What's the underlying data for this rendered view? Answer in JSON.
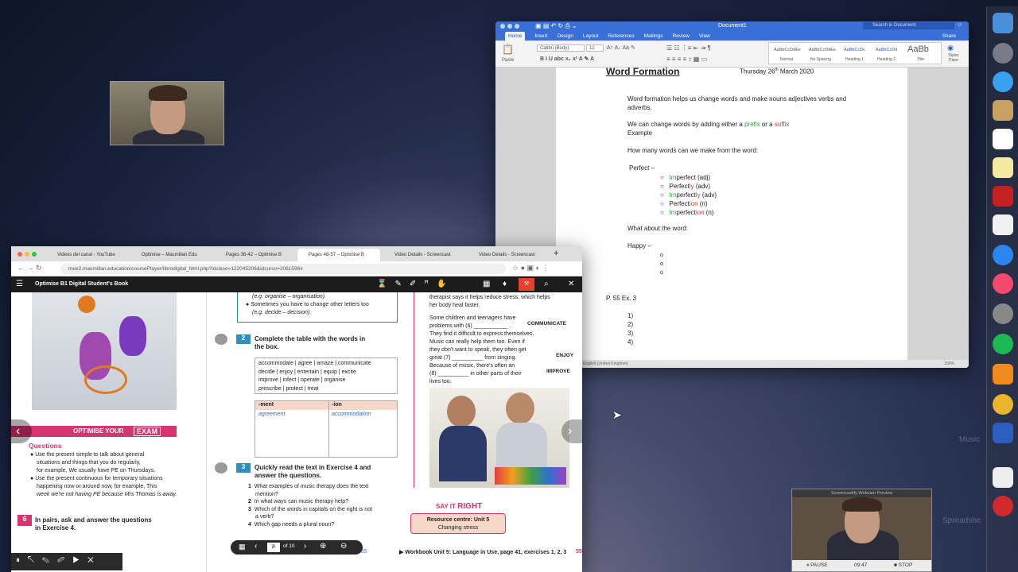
{
  "word": {
    "window_title": "Document1",
    "search_placeholder": "Search in Document",
    "share": "Share",
    "tabs": [
      "Home",
      "Insert",
      "Design",
      "Layout",
      "References",
      "Mailings",
      "Review",
      "View"
    ],
    "font_name": "Calibri (Body)",
    "font_size": "12",
    "paste": "Paste",
    "styles": [
      {
        "preview": "AaBbCcDdEe",
        "name": "Normal"
      },
      {
        "preview": "AaBbCcDdEe",
        "name": "No Spacing"
      },
      {
        "preview": "AaBbCcDc",
        "name": "Heading 1"
      },
      {
        "preview": "AaBbCcDd",
        "name": "Heading 2"
      },
      {
        "preview": "AaBb",
        "name": "Title"
      }
    ],
    "styles_pane": "Styles Pane",
    "status_language": "English (United Kingdom)",
    "zoom": "150%",
    "doc": {
      "heading": "Word Formation",
      "date": "Thursday 26",
      "date_sup": "th",
      "date_rest": " March 2020",
      "p1": "Word formation helps us change words and make nouns adjectives verbs and adverbs.",
      "p2_pre": "We can change words by adding either a ",
      "prefix": "prefix",
      "p2_mid": " or a ",
      "suffix": "suffix",
      "example": "Example",
      "question": "How many words can we make from the word:",
      "perfect": "Perfect –",
      "list": [
        {
          "pre": "Im",
          "mid": "perfect",
          "post": "",
          "tag": " (adj)"
        },
        {
          "pre": "",
          "mid": "Perfect",
          "post": "ly",
          "tag": " (adv)"
        },
        {
          "pre": "Im",
          "mid": "perfect",
          "post": "ly",
          "tag": " (adv)"
        },
        {
          "pre": "",
          "mid": "Perfect",
          "post": "ion",
          "tag": " (n)"
        },
        {
          "pre": "Im",
          "mid": "perfect",
          "post": "ion",
          "tag": " (n)"
        }
      ],
      "what_about": "What about the word:",
      "happy": "Happy –",
      "bullet": "o",
      "exercise": "P. 55 Ex. 3",
      "numbers": [
        "1)",
        "2)",
        "3)",
        "4)"
      ]
    }
  },
  "chrome": {
    "tabs": [
      "Videos del canal - YouTube",
      "Optimise – Macmillan Edu",
      "Pages 36-42 – Optimise B",
      "Pages 48-57 – Optimise B",
      "Video Details - Screencast",
      "Video Details - Screencast"
    ],
    "url": "mee2.macmillan.education/coursePlayer/librodigital_html.php?idclase=122045206&idcurso=2061596#",
    "book_title": "Optimise B1 Digital Student's Book",
    "page_current": "8",
    "page_total": "of 10",
    "left": {
      "optimise_label": "OPTIMISE YOUR",
      "exam_label": "EXAM",
      "questions": "Questions",
      "b1": "Use the present simple to talk about general",
      "b1b": "situations and things that you do regularly,",
      "b1c": "for example, We usually have PE on Thursdays.",
      "b2": "Use the present continuous for temporary situations",
      "b2b": "happening now or around now, for example, This",
      "b2c": "week we're not having PE because Mrs Thomas is away.",
      "ex6_num": "6",
      "ex6": "In pairs, ask and answer the questions",
      "ex6b": "in Exercise 4."
    },
    "middle": {
      "tip1": "(e.g. organise – organisation).",
      "tip2": "Sometimes you have to change other letters too",
      "tip2b": "(e.g. decide – decision).",
      "ex2_num": "2",
      "ex2": "Complete the table with the words in",
      "ex2b": "the box.",
      "box": [
        "accommodate | agree | amaze | communicate",
        "decide | enjoy | entertain | equip | excite",
        "improve | infect | operate | organise",
        "prescribe | protect | treat"
      ],
      "col1": "-ment",
      "col2": "-ion",
      "cell1": "agreement",
      "cell2": "accommodation",
      "ex3_num": "3",
      "ex3": "Quickly read the text in Exercise 4 and",
      "ex3b": "answer the questions.",
      "q": [
        {
          "n": "1",
          "t": "What examples of music therapy does the text",
          "t2": "mention?"
        },
        {
          "n": "2",
          "t": "In what ways can music therapy help?",
          "t2": ""
        },
        {
          "n": "3",
          "t": "Which of the words in capitals on the right is not",
          "t2": "a verb?"
        },
        {
          "n": "4",
          "t": "Which gap needs a plural noun?",
          "t2": ""
        }
      ]
    },
    "right": {
      "lines": [
        "therapist says it helps reduce stress, which helps",
        "her body heal faster.",
        "",
        "Some children and teenagers have",
        "problems with (6) ___________ .",
        "They find it difficult to express themselves.",
        "Music can really help them too. Even if",
        "they don't want to speak, they often get",
        "great (7) __________ from singing.",
        "Because of music, there's often an",
        "(8) __________ in other parts of their",
        "lives too."
      ],
      "caps": [
        "COMMUNICATE",
        "ENJOY",
        "IMPROVE"
      ],
      "say_it": "SAY IT",
      "right_word": "RIGHT",
      "resource": "Resource centre: Unit 5",
      "resource2": "Changing stress",
      "workbook": "▶ Workbook Unit 5: Language in Use, page 41, exercises 1, 2, 3",
      "page_ref": "page 165",
      "page_num": "55"
    }
  },
  "screencastify": {
    "title": "Screencastify Webcam Preview",
    "pause": "PAUSE",
    "time": "09:47",
    "stop": "STOP"
  },
  "desktop": {
    "bg_text": [
      "Music",
      "Spreadshe"
    ]
  },
  "colors": {
    "word_blue": "#3b6fd8",
    "prefix_green": "#3aa038",
    "suffix_red": "#d83a2e",
    "exam_pink": "#d6356f",
    "book_teal": "#2f8f7f"
  }
}
